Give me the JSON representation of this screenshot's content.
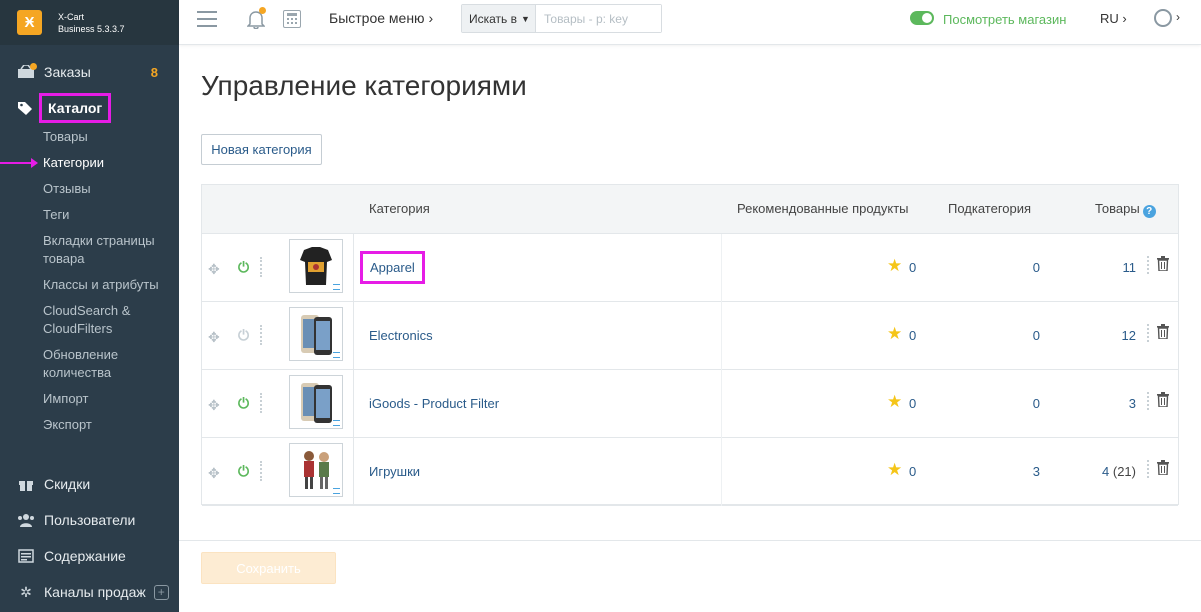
{
  "brand": {
    "name": "X-Cart",
    "edition": "Business 5.3.3.7"
  },
  "sidebar": {
    "orders": {
      "label": "Заказы",
      "count": "8"
    },
    "catalog": {
      "label": "Каталог"
    },
    "catalog_items": [
      {
        "label": "Товары"
      },
      {
        "label": "Категории"
      },
      {
        "label": "Отзывы"
      },
      {
        "label": "Теги"
      },
      {
        "label": "Вкладки страницы товара"
      },
      {
        "label": "Классы и атрибуты"
      },
      {
        "label": "CloudSearch & CloudFilters"
      },
      {
        "label": "Обновление количества"
      },
      {
        "label": "Импорт"
      },
      {
        "label": "Экспорт"
      }
    ],
    "bottom_items": [
      {
        "label": "Скидки"
      },
      {
        "label": "Пользователи"
      },
      {
        "label": "Содержание"
      },
      {
        "label": "Каналы продаж"
      }
    ]
  },
  "header": {
    "quick_menu": "Быстрое меню",
    "search_in": "Искать в",
    "search_placeholder": "Товары - р: key",
    "view_store": "Посмотреть магазин",
    "lang": "RU"
  },
  "main": {
    "title": "Управление категориями",
    "new_category": "Новая категория",
    "save": "Сохранить"
  },
  "table": {
    "columns": {
      "category": "Категория",
      "recommended": "Рекомендованные продукты",
      "subcategories": "Подкатегория",
      "products": "Товары"
    },
    "rows": [
      {
        "name": "Apparel",
        "recommended": "0",
        "subcategories": "0",
        "products": "11",
        "products_extra": "",
        "enabled": true
      },
      {
        "name": "Electronics",
        "recommended": "0",
        "subcategories": "0",
        "products": "12",
        "products_extra": "",
        "enabled": false
      },
      {
        "name": "iGoods - Product Filter",
        "recommended": "0",
        "subcategories": "0",
        "products": "3",
        "products_extra": "",
        "enabled": true
      },
      {
        "name": "Игрушки",
        "recommended": "0",
        "subcategories": "3",
        "products": "4",
        "products_extra": "(21)",
        "enabled": true
      }
    ]
  },
  "colors": {
    "sidebar_bg": "#2c3d4a",
    "accent_orange": "#f5a623",
    "link_blue": "#2a5b8a",
    "green": "#5cb85c",
    "highlight_magenta": "#e61ce6"
  }
}
